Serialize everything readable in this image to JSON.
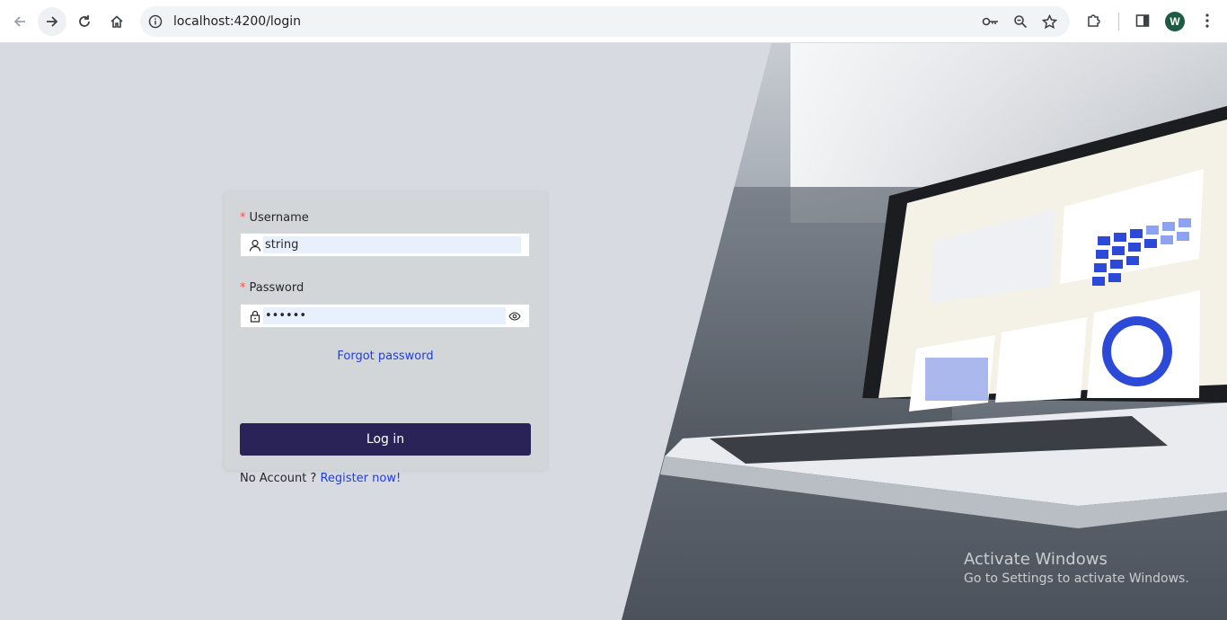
{
  "browser": {
    "url": "localhost:4200/login",
    "profile_initial": "W"
  },
  "login": {
    "username_label": "Username",
    "username_value": "string",
    "password_label": "Password",
    "password_value": "••••••",
    "required_mark": "*",
    "forgot_password": "Forgot password",
    "login_button": "Log in",
    "no_account_text": "No Account ?",
    "register_link": "Register now!"
  },
  "watermark": {
    "title": "Activate Windows",
    "subtitle": "Go to Settings to activate Windows."
  },
  "colors": {
    "primary_button": "#2a2357",
    "link": "#1c3ee6",
    "required": "#ff4d4f",
    "page_background": "#d7dae0"
  }
}
